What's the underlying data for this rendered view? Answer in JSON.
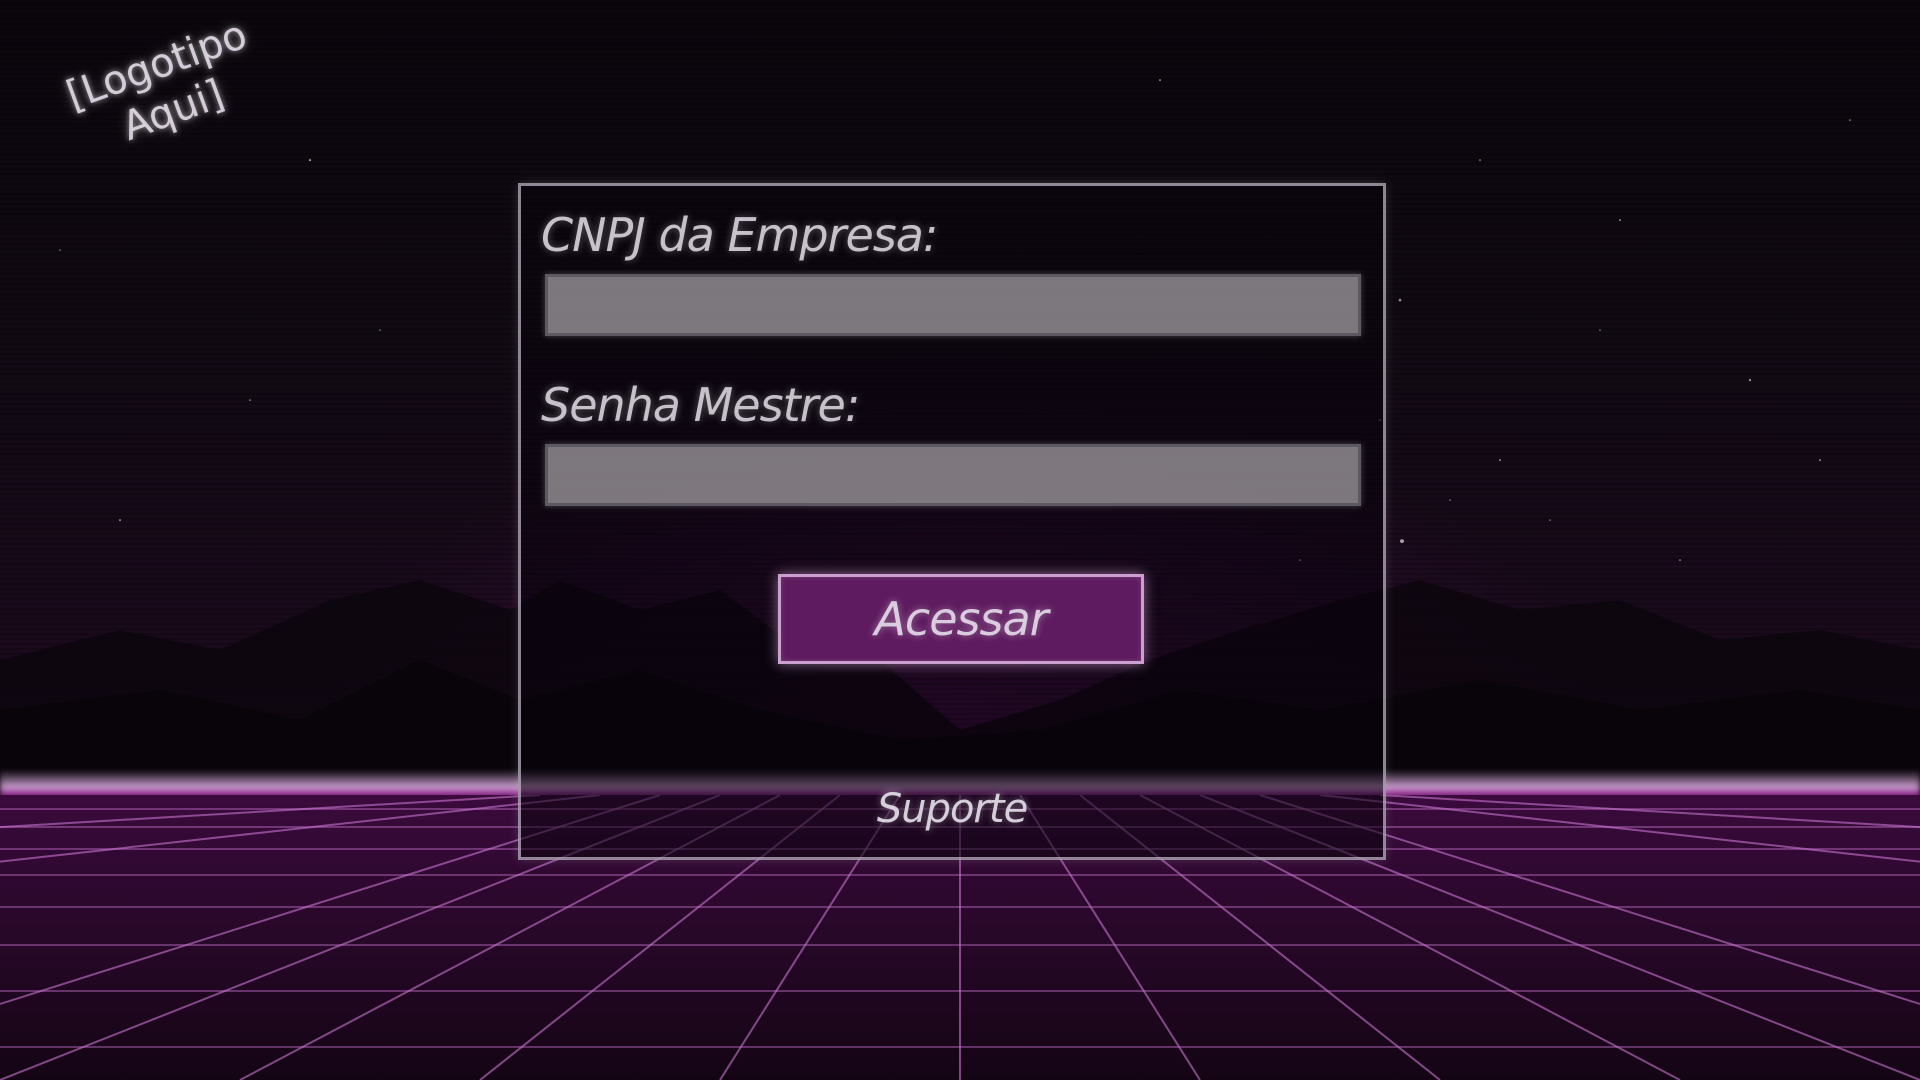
{
  "logo": {
    "line1": "[Logotipo",
    "line2": "Aqui]"
  },
  "login_form": {
    "cnpj_label": "CNPJ da Empresa:",
    "cnpj_value": "",
    "password_label": "Senha Mestre:",
    "password_value": "",
    "submit_label": "Acessar",
    "support_label": "Suporte"
  },
  "theme": {
    "background": "#120a14",
    "accent": "#5e1b5f",
    "grid_color": "#c874d0",
    "input_fill": "#969196"
  }
}
